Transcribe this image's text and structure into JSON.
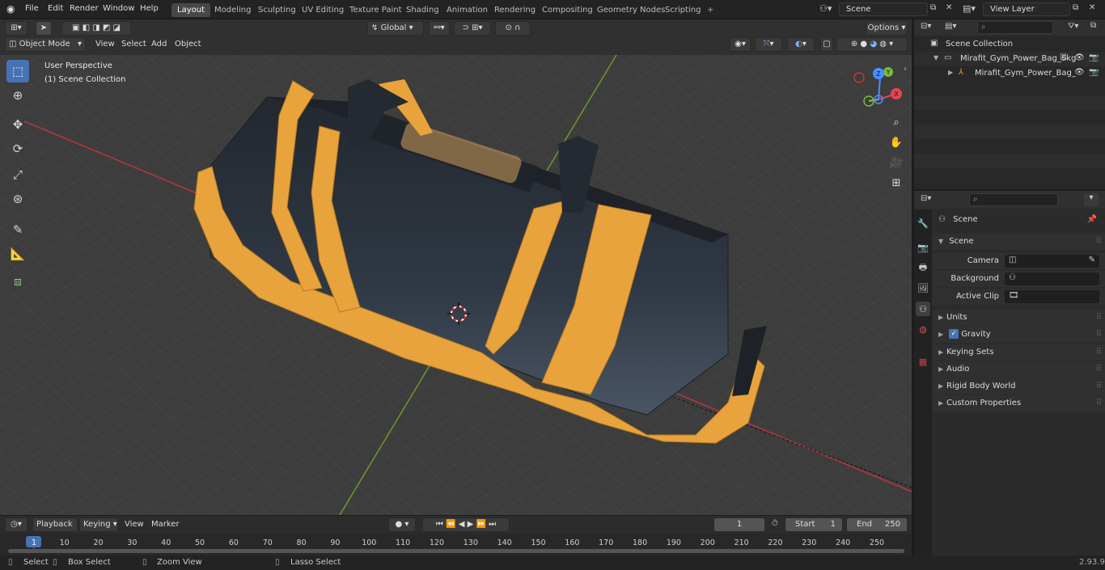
{
  "topbar": {
    "menus": [
      "File",
      "Edit",
      "Render",
      "Window",
      "Help"
    ],
    "workspaces": [
      "Layout",
      "Modeling",
      "Sculpting",
      "UV Editing",
      "Texture Paint",
      "Shading",
      "Animation",
      "Rendering",
      "Compositing",
      "Geometry Nodes",
      "Scripting"
    ],
    "active_workspace": "Layout",
    "add_tab": "+",
    "scene": "Scene",
    "view_layer": "View Layer"
  },
  "viewport_header": {
    "transform_orientation": "Global",
    "options": "Options",
    "mode": "Object Mode",
    "menus": [
      "View",
      "Select",
      "Add",
      "Object"
    ]
  },
  "viewport": {
    "perspective": "User Perspective",
    "collection": "(1) Scene Collection",
    "gizmo": {
      "x": "X",
      "y": "Y",
      "z": "Z"
    },
    "accent": "#e8a33d"
  },
  "outliner": {
    "root": "Scene Collection",
    "items": [
      "Mirafit_Gym_Power_Bag_5kg",
      "Mirafit_Gym_Power_Bag_"
    ]
  },
  "properties": {
    "context": "Scene",
    "panel": "Scene",
    "fields": [
      "Camera",
      "Background Scene",
      "Active Clip"
    ],
    "sections": [
      "Units",
      "Gravity",
      "Keying Sets",
      "Audio",
      "Rigid Body World",
      "Custom Properties"
    ],
    "gravity_checked": true
  },
  "timeline": {
    "menus": [
      "Playback",
      "Keying",
      "View",
      "Marker"
    ],
    "current_frame": "1",
    "start_label": "Start",
    "start": "1",
    "end_label": "End",
    "end": "250",
    "ticks": [
      "1",
      "10",
      "20",
      "30",
      "40",
      "50",
      "60",
      "70",
      "80",
      "90",
      "100",
      "110",
      "120",
      "130",
      "140",
      "150",
      "160",
      "170",
      "180",
      "190",
      "200",
      "210",
      "220",
      "230",
      "240",
      "250"
    ]
  },
  "statusbar": {
    "select": "Select",
    "box_select": "Box Select",
    "zoom_view": "Zoom View",
    "lasso_select": "Lasso Select",
    "version": "2.93.9"
  }
}
